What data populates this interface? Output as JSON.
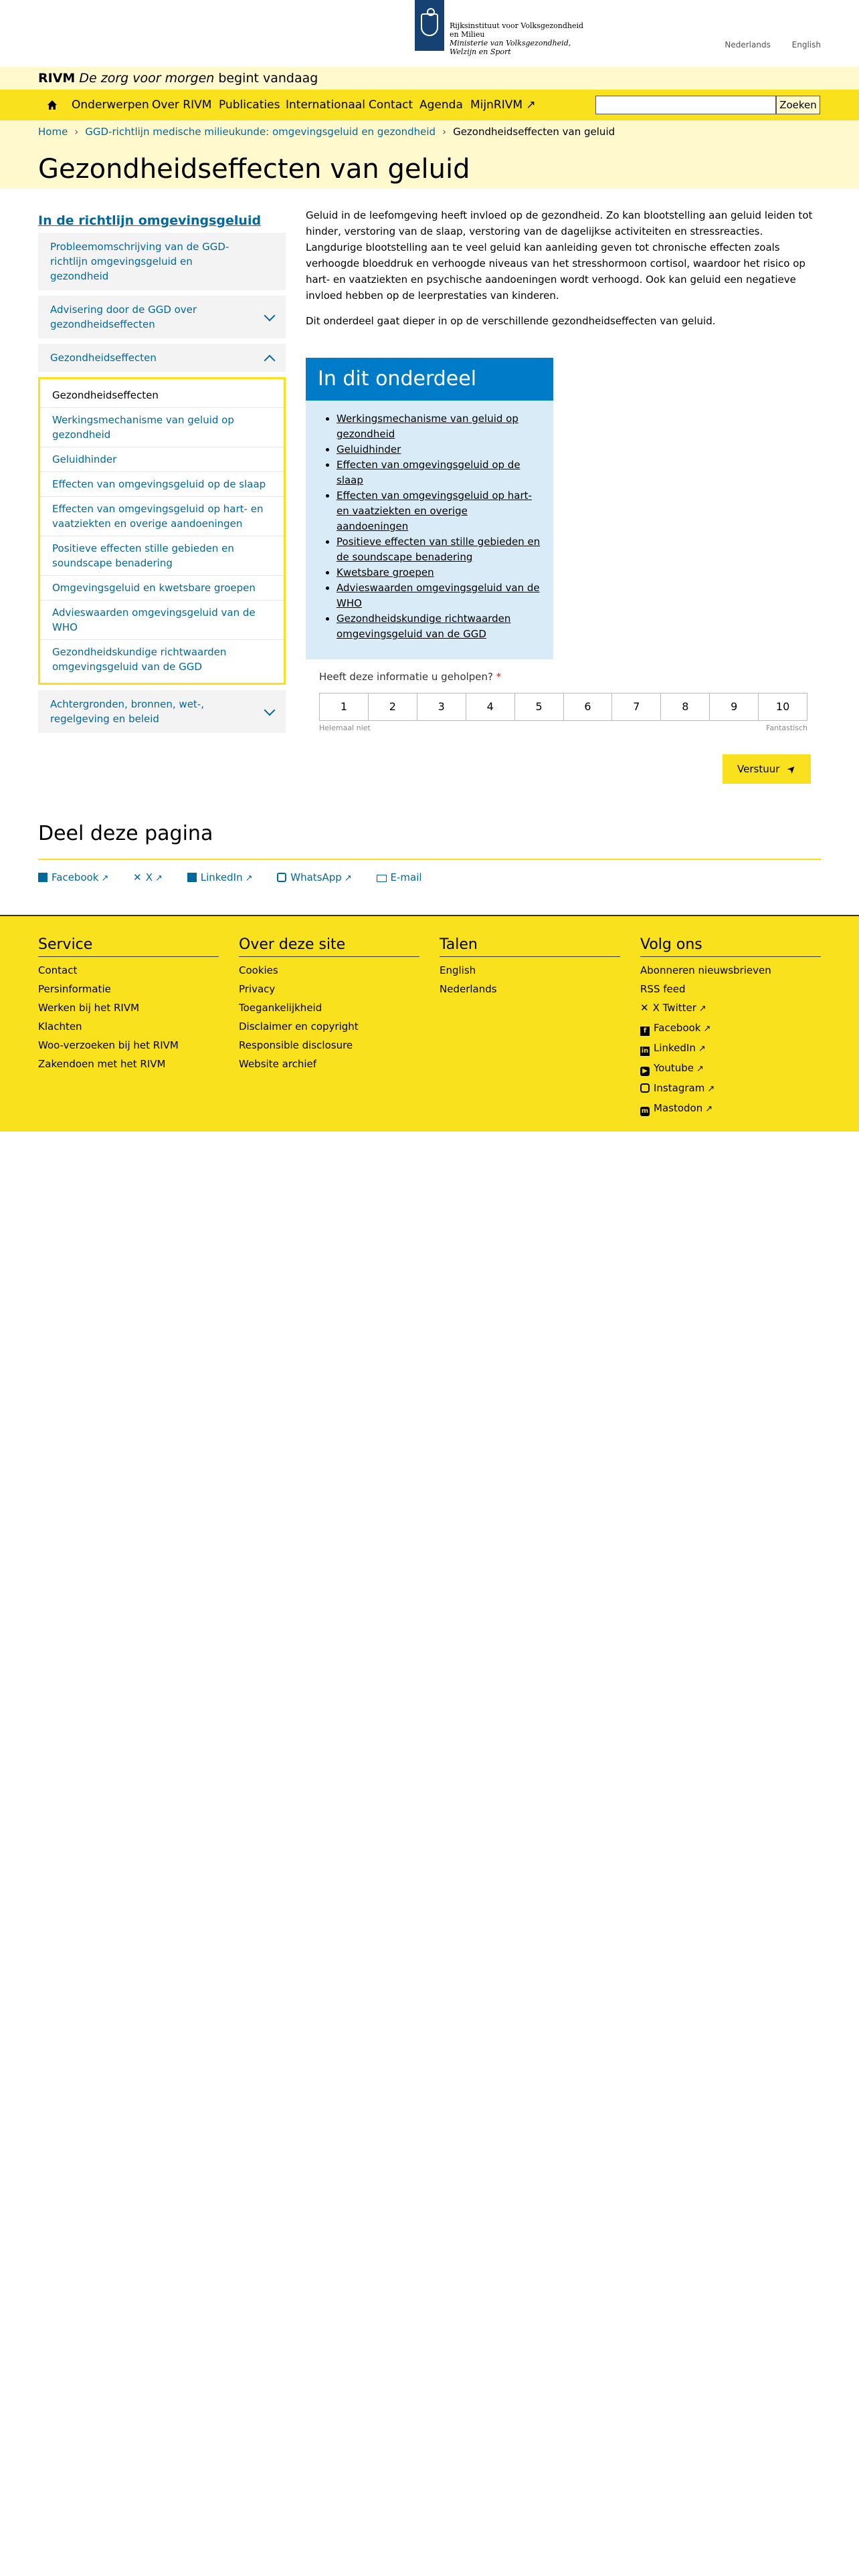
{
  "header": {
    "logo_lines": [
      "Rijksinstituut voor Volksgezondheid",
      "en Milieu",
      "Ministerie van Volksgezondheid,",
      "Welzijn en Sport"
    ],
    "lang_nl": "Nederlands",
    "lang_en": "English"
  },
  "tagline": {
    "brand": "RIVM",
    "italic": "De zorg voor morgen",
    "rest": "begint vandaag"
  },
  "nav": {
    "items": [
      "Onderwerpen",
      "Over RIVM",
      "Publicaties",
      "Internationaal",
      "Contact",
      "Agenda",
      "MijnRIVM ↗"
    ],
    "search_value": "",
    "search_button": "Zoeken"
  },
  "breadcrumb": [
    "Home",
    "GGD-richtlijn medische milieukunde: omgevingsgeluid en gezondheid",
    "Gezondheidseffecten van geluid"
  ],
  "page_title": "Gezondheidseffecten van geluid",
  "sidebar": {
    "title": "In de richtlijn omgevingsgeluid",
    "item1": "Probleemomschrijving van de GGD-richtlijn omgevingsgeluid en gezondheid",
    "item2": "Advisering door de GGD over gezondheidseffecten",
    "item3": "Gezondheidseffecten",
    "sub": [
      "Gezondheidseffecten",
      "Werkingsmechanisme van geluid op gezondheid",
      "Geluidhinder",
      "Effecten van omgevingsgeluid op de slaap",
      "Effecten van omgevingsgeluid op hart- en vaatziekten en overige aandoeningen",
      "Positieve effecten stille gebieden en soundscape benadering",
      "Omgevingsgeluid en kwetsbare groepen",
      "Advieswaarden omgevingsgeluid van de WHO",
      "Gezondheidskundige richtwaarden omgevingsgeluid van de GGD"
    ],
    "item4": "Achtergronden, bronnen, wet-, regelgeving en beleid"
  },
  "intro": {
    "p1": "Geluid in de leefomgeving heeft invloed op de gezondheid. Zo kan blootstelling aan geluid leiden tot hinder, verstoring van de slaap, verstoring van de dagelijkse activiteiten en stressreacties. Langdurige blootstelling aan te veel geluid kan aanleiding geven tot chronische effecten zoals verhoogde bloeddruk en verhoogde niveaus van het stresshormoon cortisol, waardoor het risico op hart- en vaatziekten en psychische aandoeningen wordt verhoogd. Ook kan geluid een negatieve invloed hebben op de leerprestaties van kinderen.",
    "p2": "Dit onderdeel gaat dieper in op de verschillende gezondheidseffecten van geluid."
  },
  "toc": {
    "title": "In dit onderdeel",
    "items": [
      "Werkingsmechanisme van geluid op gezondheid",
      "Geluidhinder",
      "Effecten van omgevingsgeluid op de slaap",
      "Effecten van omgevingsgeluid op hart- en vaatziekten en overige aandoeningen",
      "Positieve effecten van stille gebieden en de soundscape benadering",
      "Kwetsbare groepen",
      "Advieswaarden omgevingsgeluid van de WHO",
      "Gezondheidskundige richtwaarden omgevingsgeluid van de GGD"
    ]
  },
  "feedback": {
    "question": "Heeft deze informatie u geholpen?",
    "required_mark": "*",
    "scale": [
      "1",
      "2",
      "3",
      "4",
      "5",
      "6",
      "7",
      "8",
      "9",
      "10"
    ],
    "low": "Helemaal niet",
    "high": "Fantastisch",
    "submit": "Verstuur"
  },
  "share": {
    "title": "Deel deze pagina",
    "links": [
      "Facebook",
      "X",
      "LinkedIn",
      "WhatsApp",
      "E-mail"
    ]
  },
  "footer": {
    "service": {
      "title": "Service",
      "links": [
        "Contact",
        "Persinformatie",
        "Werken bij het RIVM",
        "Klachten",
        "Woo-verzoeken bij het RIVM",
        "Zakendoen met het RIVM"
      ]
    },
    "about": {
      "title": "Over deze site",
      "links": [
        "Cookies",
        "Privacy",
        "Toegankelijkheid",
        "Disclaimer en copyright",
        "Responsible disclosure",
        "Website archief"
      ]
    },
    "languages": {
      "title": "Talen",
      "links": [
        "English",
        "Nederlands"
      ]
    },
    "follow": {
      "title": "Volg ons",
      "links": [
        "Abonneren nieuwsbrieven",
        "RSS feed",
        "X Twitter",
        "Facebook",
        "LinkedIn",
        "Youtube",
        "Instagram",
        "Mastodon"
      ]
    }
  },
  "colors": {
    "yellow": "#f9e11e",
    "light_yellow": "#fff9cd",
    "link_blue": "#01689b",
    "toc_blue": "#007bc7",
    "toc_bg": "#d9ebf7",
    "logo_blue": "#154273"
  }
}
